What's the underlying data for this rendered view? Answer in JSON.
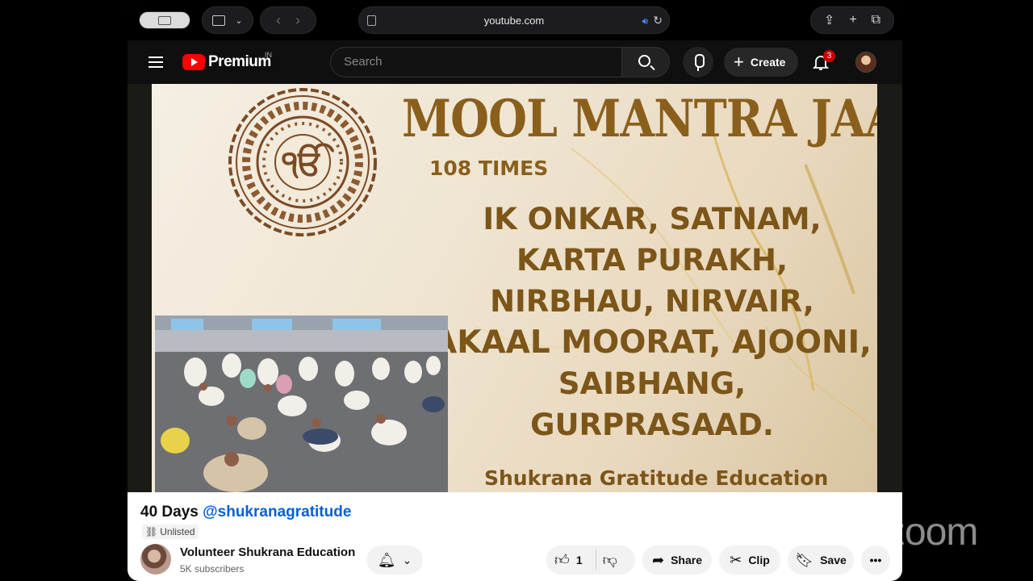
{
  "browser": {
    "url": "youtube.com"
  },
  "header": {
    "logo_text": "Premium",
    "region": "IN",
    "search_placeholder": "Search",
    "create_label": "Create",
    "notification_count": "3"
  },
  "slide": {
    "title": "MOOL MANTRA JAAP",
    "subtitle": "108 TIMES",
    "mantra_lines": [
      "IK ONKAR, SATNAM,",
      "KARTA PURAKH,",
      "NIRBHAU, NIRVAIR,",
      "AKAAL MOORAT, AJOONI,",
      "SAIBHANG,",
      "GURPRASAAD."
    ],
    "footer": "Shukrana Gratitude Education"
  },
  "video": {
    "title": "40 Days",
    "handle": "@shukranagratitude",
    "visibility": "Unlisted",
    "channel_name": "Volunteer Shukrana Education",
    "subscribers": "5K subscribers",
    "like_count": "1",
    "share_label": "Share",
    "clip_label": "Clip",
    "save_label": "Save"
  },
  "watermark": "zoom",
  "colors": {
    "yt_red": "#ff0000",
    "title_gold": "#8a5f1c",
    "link_blue": "#065fd4"
  }
}
